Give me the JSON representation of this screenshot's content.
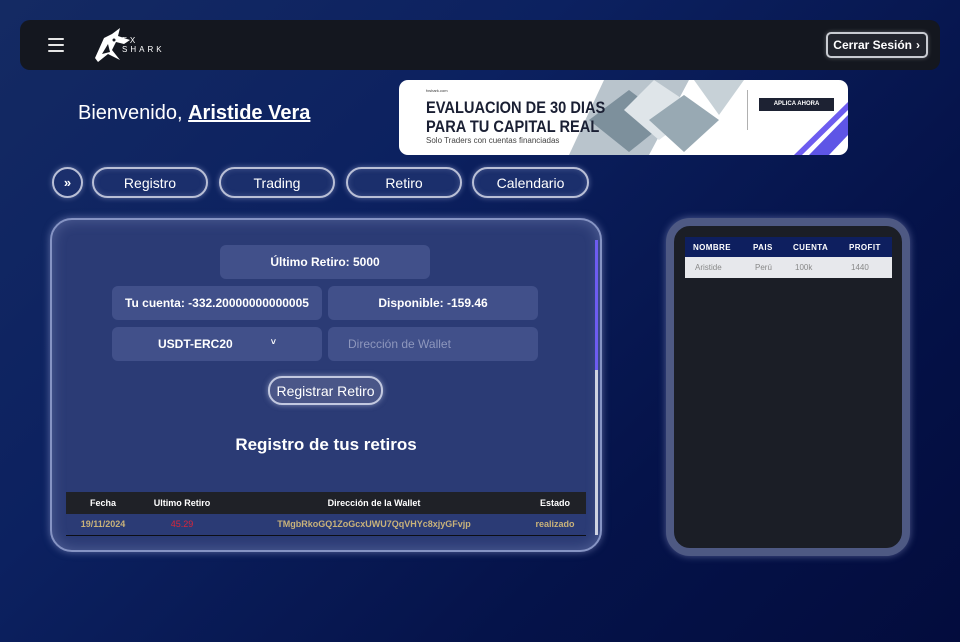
{
  "header": {
    "logo_text_1": "FX",
    "logo_text_2": "SHARK",
    "logout_label": "Cerrar Sesión",
    "logout_icon": "chevron-right-icon"
  },
  "welcome": {
    "prefix": "Bienvenido,",
    "user_name": "Aristide Vera"
  },
  "banner": {
    "site": "fxshark.com",
    "line1": "EVALUACION DE 30 DIAS",
    "line2": "PARA TU CAPITAL REAL",
    "line3": "Solo Traders con cuentas financiadas",
    "cta": "APLICA AHORA"
  },
  "nav": {
    "toggle_icon": "chevron-right-icon",
    "items": [
      {
        "label": "Registro"
      },
      {
        "label": "Trading"
      },
      {
        "label": "Retiro"
      },
      {
        "label": "Calendario"
      }
    ]
  },
  "withdraw": {
    "last_withdraw": "Último Retiro: 5000",
    "account": "Tu cuenta: -332.20000000000005",
    "available": "Disponible: -159.46",
    "network_selected": "USDT-ERC20",
    "wallet_placeholder": "Dirección de Wallet",
    "submit_label": "Registrar Retiro",
    "history_title": "Registro de tus retiros",
    "columns": [
      "Fecha",
      "Ultimo Retiro",
      "Dirección de la Wallet",
      "Estado"
    ],
    "rows": [
      {
        "date": "19/11/2024",
        "amount": "45.29",
        "wallet": "TMgbRkoGQ1ZoGcxUWU7QqVHYc8xjyGFvjp",
        "status": "realizado"
      }
    ]
  },
  "profit": {
    "columns": [
      "NOMBRE",
      "PAIS",
      "CUENTA",
      "PROFIT"
    ],
    "rows": [
      {
        "name": "Aristide",
        "country": "Perú",
        "account": "100k",
        "profit": "1440"
      }
    ]
  },
  "colors": {
    "accent_purple": "#6d5cf0",
    "amount_red": "#d9263a",
    "status_gold": "#c9b27a",
    "header_navy": "#0e1f5f"
  }
}
